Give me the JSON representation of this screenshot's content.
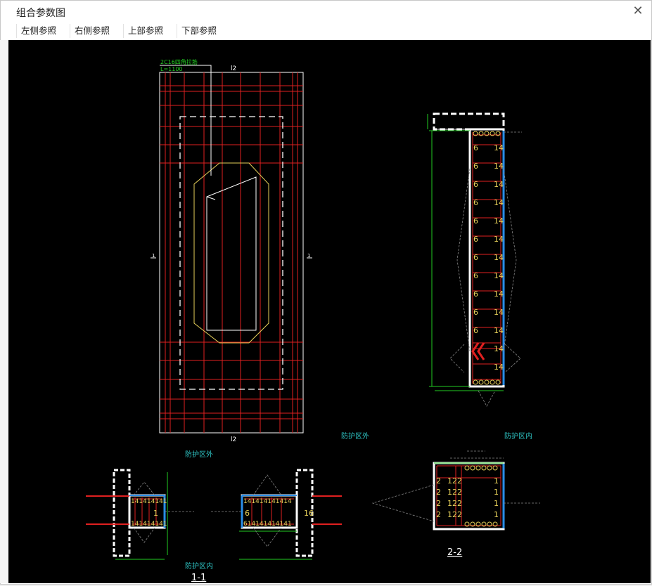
{
  "window": {
    "title": "组合参数图"
  },
  "toolbar": {
    "buttons": [
      "左侧参照",
      "右侧参照",
      "上部参照",
      "下部参照"
    ]
  },
  "drawing": {
    "plan": {
      "callout_line1": "2C16四角拉筋",
      "callout_line2": "L=1100",
      "top_mark": "l2",
      "bottom_mark": "l2",
      "left_mark": "1",
      "right_mark": "1"
    },
    "zone_outside_top": "防护区外",
    "zone_inside_top": "防护区内",
    "zone_outside_left": "防护区外",
    "zone_inside_left": "防护区内",
    "section_11": "1-1",
    "section_22": "2-2",
    "bar_label_6": "6",
    "bar_label_14": "14"
  },
  "colors": {
    "red": "#e02020",
    "green": "#22cc22",
    "cyan": "#2ec4c4",
    "yellow": "#e6d05a",
    "blue": "#2a8ee8"
  }
}
